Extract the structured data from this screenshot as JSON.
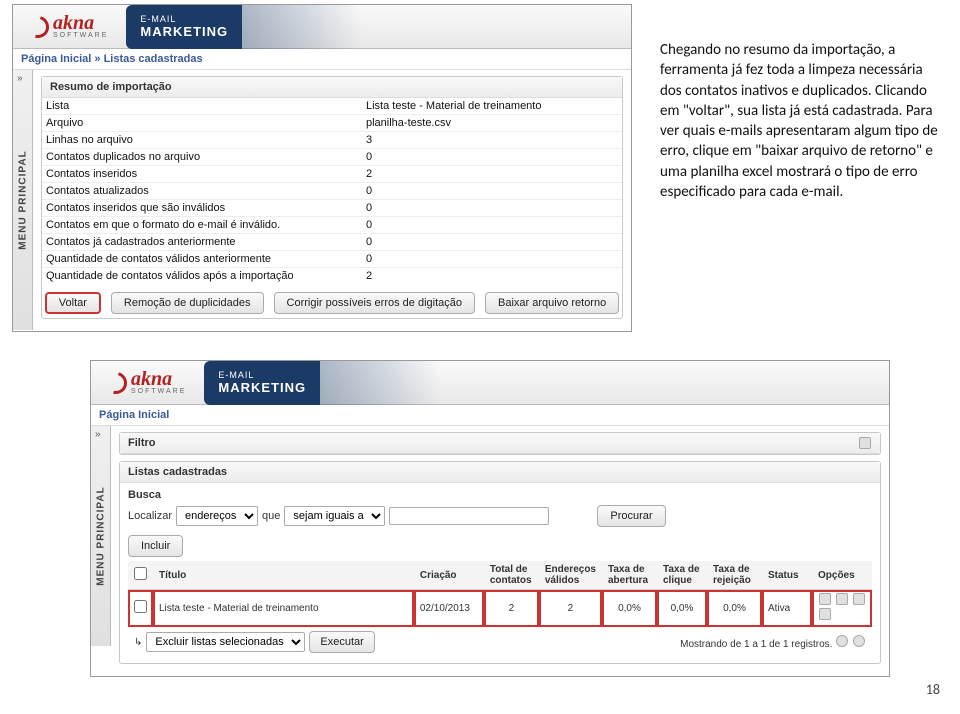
{
  "brand": {
    "name": "akna",
    "sub": "SOFTWARE",
    "badge_l1": "E-MAIL",
    "badge_l2": "MARKETING"
  },
  "side_rail": {
    "label": "MENU PRINCIPAL",
    "caret": "»"
  },
  "win1": {
    "breadcrumb": {
      "root": "Página Inicial",
      "sep": "»",
      "current": "Listas cadastradas"
    },
    "panel_title": "Resumo de importação",
    "rows": [
      {
        "label": "Lista",
        "value": "Lista teste - Material de treinamento"
      },
      {
        "label": "Arquivo",
        "value": "planilha-teste.csv"
      },
      {
        "label": "Linhas no arquivo",
        "value": "3"
      },
      {
        "label": "Contatos duplicados no arquivo",
        "value": "0"
      },
      {
        "label": "Contatos inseridos",
        "value": "2"
      },
      {
        "label": "Contatos atualizados",
        "value": "0"
      },
      {
        "label": "Contatos inseridos que são inválidos",
        "value": "0"
      },
      {
        "label": "Contatos em que o formato do e-mail é inválido.",
        "value": "0"
      },
      {
        "label": "Contatos já cadastrados anteriormente",
        "value": "0"
      },
      {
        "label": "Quantidade de contatos válidos anteriormente",
        "value": "0"
      },
      {
        "label": "Quantidade de contatos válidos após a importação",
        "value": "2"
      }
    ],
    "buttons": {
      "voltar": "Voltar",
      "dedup": "Remoção de duplicidades",
      "corrigir": "Corrigir possíveis erros de digitação",
      "baixar": "Baixar arquivo retorno"
    }
  },
  "win2": {
    "breadcrumb": {
      "root": "Página Inicial"
    },
    "filtro_title": "Filtro",
    "lists_title": "Listas cadastradas",
    "busca_title": "Busca",
    "search": {
      "localizar": "Localizar",
      "field_opt": "endereços",
      "que": "que",
      "cond_opt": "sejam iguais a",
      "procurar": "Procurar"
    },
    "incluir": "Incluir",
    "columns": {
      "checkbox": "",
      "titulo": "Título",
      "criacao": "Criação",
      "total": "Total de contatos",
      "validos": "Endereços válidos",
      "abertura": "Taxa de abertura",
      "clique": "Taxa de clique",
      "rejeicao": "Taxa de rejeição",
      "status": "Status",
      "opcoes": "Opções"
    },
    "row": {
      "titulo": "Lista teste - Material de treinamento",
      "criacao": "02/10/2013",
      "total": "2",
      "validos": "2",
      "abertura": "0,0%",
      "clique": "0,0%",
      "rejeicao": "0,0%",
      "status": "Ativa"
    },
    "footer": {
      "arrow": "↳",
      "action_opt": "Excluir listas selecionadas",
      "executar": "Executar",
      "paginator": "Mostrando de 1 a 1 de 1 registros."
    }
  },
  "instructions": "Chegando no resumo da importação, a ferramenta já fez toda a limpeza necessária dos contatos inativos e duplicados. Clicando em \"voltar\", sua lista já está cadastrada. Para ver quais e-mails apresentaram algum tipo de erro, clique em \"baixar arquivo de retorno\" e uma planilha excel mostrará o tipo de erro especificado para cada e-mail.",
  "page_number": "18"
}
